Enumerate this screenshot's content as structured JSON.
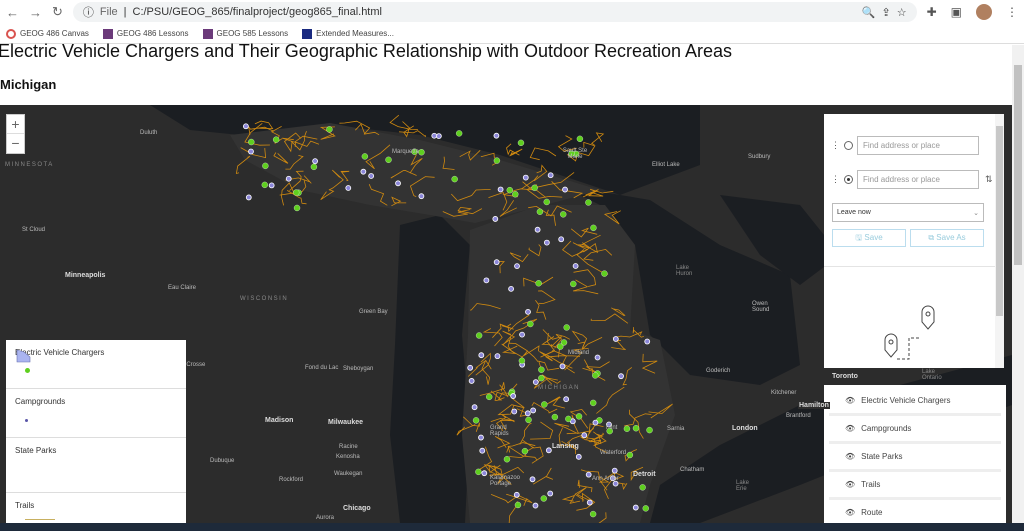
{
  "browser": {
    "file_label": "File",
    "url": "C:/PSU/GEOG_865/finalproject/geog865_final.html",
    "bookmarks": [
      {
        "label": "GEOG 486 Canvas",
        "color": "#d9534f"
      },
      {
        "label": "GEOG 486 Lessons",
        "color": "#6b3a7a"
      },
      {
        "label": "GEOG 585 Lessons",
        "color": "#6b3a7a"
      },
      {
        "label": "Extended Measures...",
        "color": "#1a2a80"
      }
    ]
  },
  "page": {
    "title": "Electric Vehicle Chargers and Their Geographic Relationship with Outdoor Recreation Areas",
    "subtitle": "Michigan"
  },
  "map": {
    "zoom_in": "+",
    "zoom_out": "−",
    "labels": {
      "duluth": "Duluth",
      "minnesota": "MINNESOTA",
      "st_cloud": "St Cloud",
      "minneapolis": "Minneapolis",
      "eau_claire": "Eau Claire",
      "wisconsin": "WISCONSIN",
      "green_bay": "Green Bay",
      "la_crosse": "La Crosse",
      "fond_du_lac": "Fond du Lac",
      "sheboygan": "Sheboygan",
      "madison": "Madison",
      "milwaukee": "Milwaukee",
      "racine": "Racine",
      "kenosha": "Kenosha",
      "waukegan": "Waukegan",
      "dubuque": "Dubuque",
      "rockford": "Rockford",
      "chicago": "Chicago",
      "aurora": "Aurora",
      "marquette": "Marquette",
      "sault": "Sault Ste Marie",
      "elliot_lake": "Elliot Lake",
      "sudbury": "Sudbury",
      "lake_huron": "Lake Huron",
      "owen_sound": "Owen Sound",
      "midland": "Midland",
      "michigan": "MICHIGAN",
      "goderich": "Goderich",
      "kitchener": "Kitchener",
      "brantford": "Brantford",
      "hamilton": "Hamilton",
      "london": "London",
      "sarnia": "Sarnia",
      "lansing": "Lansing",
      "grand_rapids": "Grand Rapids",
      "kalamazoo": "Kalamazoo Portage",
      "ann_arbor": "Ann Arbor",
      "detroit": "Detroit",
      "chatham": "Chatham",
      "lake_erie": "Lake Erie",
      "lake_ontario": "Lake Ontario",
      "flint": "Flint",
      "waterford": "Waterford",
      "toronto": "Toronto"
    }
  },
  "legend": [
    {
      "title": "Electric Vehicle Chargers"
    },
    {
      "title": "Campgrounds"
    },
    {
      "title": "State Parks"
    },
    {
      "title": "Trails"
    }
  ],
  "directions": {
    "from_placeholder": "Find address or place",
    "to_placeholder": "Find address or place",
    "depart": "Leave now",
    "save": "Save",
    "save_as": "Save As"
  },
  "layers": [
    {
      "label": "Electric Vehicle Chargers"
    },
    {
      "label": "Campgrounds"
    },
    {
      "label": "State Parks"
    },
    {
      "label": "Trails"
    },
    {
      "label": "Route"
    }
  ],
  "colors": {
    "charger": "#5fcf1f",
    "campground": "#8b86d8",
    "trail": "#d08a10",
    "park": "#aab4f0"
  }
}
